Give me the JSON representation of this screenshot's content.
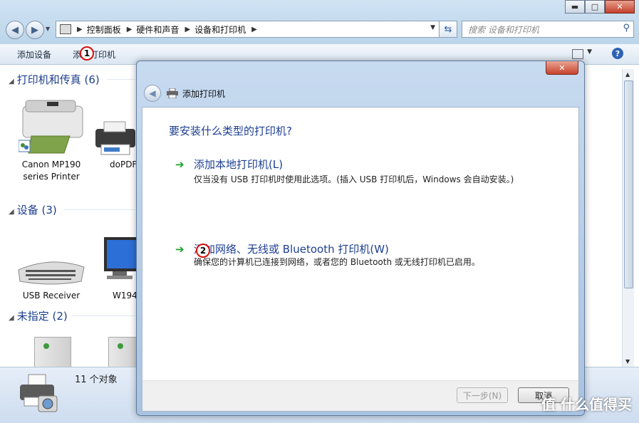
{
  "window": {
    "caption_min": "▬",
    "caption_max": "□",
    "caption_close": "✕"
  },
  "address": {
    "crumbs": [
      "控制面板",
      "硬件和声音",
      "设备和打印机"
    ],
    "search_placeholder": "搜索 设备和打印机"
  },
  "toolbar": {
    "add_device": "添加设备",
    "add_printer": "添加打印机"
  },
  "annotations": {
    "badge1": "1",
    "badge2": "2"
  },
  "groups": [
    {
      "label": "打印机和传真 (6)"
    },
    {
      "label": "设备 (3)"
    },
    {
      "label": "未指定 (2)"
    }
  ],
  "devices": {
    "printer1_line1": "Canon MP190",
    "printer1_line2": "series Printer",
    "printer2": "doPDF",
    "device1": "USB Receiver",
    "device2": "W194"
  },
  "details": {
    "count": "11 个对象"
  },
  "dialog": {
    "title": "添加打印机",
    "question": "要安装什么类型的打印机?",
    "option1_title": "添加本地打印机(L)",
    "option1_desc": "仅当没有 USB 打印机时使用此选项。(插入 USB 打印机后，Windows 会自动安装。)",
    "option2_title": "添加网络、无线或 Bluetooth 打印机(W)",
    "option2_desc": "确保您的计算机已连接到网络，或者您的 Bluetooth 或无线打印机已启用。",
    "next_button": "下一步(N)",
    "cancel_button": "取消",
    "close_label": "✕"
  },
  "watermark": "值 什么值得买"
}
